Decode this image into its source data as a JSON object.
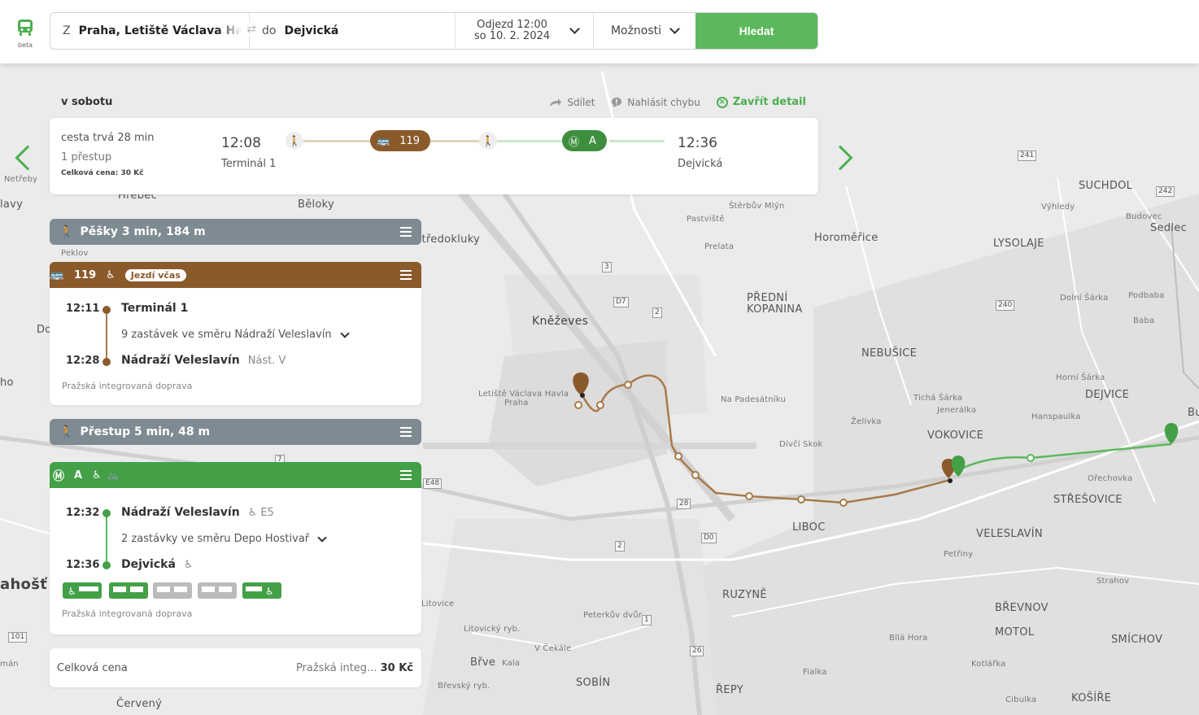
{
  "logo": {
    "beta": "beta",
    "icon": "bus-icon"
  },
  "search": {
    "from_prefix": "Z",
    "from_value": "Praha, Letiště Václava Havla",
    "to_prefix": "do",
    "to_value": "Dejvická",
    "depart_line1": "Odjezd 12:00",
    "depart_line2": "so 10. 2. 2024",
    "options_label": "Možnosti",
    "search_button": "Hledat"
  },
  "detail": {
    "day_label": "v sobotu",
    "share": "Sdílet",
    "report": "Nahlásit chybu",
    "close": "Zavřít detail"
  },
  "summary": {
    "duration": "cesta trvá 28 min",
    "transfers": "1 přestup",
    "price": "Celková cena: 30 Kč",
    "depart_time": "12:08",
    "depart_stop": "Terminál 1",
    "arrive_time": "12:36",
    "arrive_stop": "Dejvická",
    "bus_line": "119",
    "metro_line": "A"
  },
  "colors": {
    "green": "#4caf50",
    "bus_brown": "#8b5a2b",
    "metro_green": "#43a047",
    "walk_gray": "#7e8b93"
  },
  "legs": {
    "walk1": "Pěšky 3 min, 184 m",
    "bus": {
      "line": "119",
      "status": "Jezdí včas",
      "from_time": "12:11",
      "from_stop": "Terminál 1",
      "stops_info": "9 zastávek ve směru Nádraží Veleslavín",
      "to_time": "12:28",
      "to_stop": "Nádraží Veleslavín",
      "to_platform": "Nást. V",
      "operator": "Pražská integrovaná doprava"
    },
    "transfer": "Přestup 5 min, 48 m",
    "metro": {
      "line": "A",
      "from_time": "12:32",
      "from_stop": "Nádraží Veleslavín",
      "from_exit": "E5",
      "stops_info": "2 zastávky ve směru Depo Hostivař",
      "to_time": "12:36",
      "to_stop": "Dejvická",
      "operator": "Pražská integrovaná doprava"
    }
  },
  "price": {
    "label": "Celková cena",
    "provider": "Pražská integ...",
    "amount": "30 Kč"
  },
  "map": {
    "labels": {
      "belok": "Běloky",
      "hrebec": "Hrebec",
      "tredokluky": "Středokluky",
      "peklov": "Peklov",
      "knezeves": "Kněževes",
      "horomerice": "Horoměřice",
      "predni": "PŘEDNÍ",
      "kopanina": "KOPANINA",
      "nebusice": "NEBUŠICE",
      "suchdol": "SUCHDOL",
      "lysolaje": "LYSOLAJE",
      "sedlec": "Sedlec",
      "dejvice": "DEJVICE",
      "vokovice": "VOKOVICE",
      "strešovice": "STŘEŠOVICE",
      "liboc": "LIBOC",
      "veleslavin": "VELESLAVÍN",
      "ruzyne": "RUZYNĚ",
      "brevnov": "BŘEVNOV",
      "motol": "MOTOL",
      "smichov": "SMÍCHOV",
      "sobin": "SOBÍN",
      "repy": "ŘEPY",
      "kosire": "KOŠÍŘE",
      "airport1": "Letiště Václava Havla",
      "airport2": "Praha",
      "netreby": "Netřeby",
      "lavy": "lavy",
      "dot": "Do",
      "ho": "ho",
      "hostedge": "ahošť",
      "cerveny": "Červený",
      "man": "mán",
      "stbmlyn": "Štěrbův Mlýn",
      "pastviste": "Pastviště",
      "prelata": "Prelata",
      "napadesatniku": "Na Padesátníku",
      "zelivka": "Želivka",
      "divcisko": "Dívčí Skok",
      "tichasarka": "Tichá Šárka",
      "jenerálka": "Jenerálka",
      "hornisarka": "Horní Šárka",
      "hanspaulka": "Hanspaulka",
      "orechovka": "Ořechovka",
      "petriny": "Petřiny",
      "strahov": "Strahov",
      "vyhledy": "Výhledy",
      "budovec": "Budovec",
      "dolni": "Dolní Šárka",
      "podbaba": "Podbaba",
      "baba": "Baba",
      "bilahora": "Bílá Hora",
      "kotlarka": "Kotlářka",
      "fialka": "Fialka",
      "petervdvur": "Peterkův dvůr",
      "vcekale": "V Čekále",
      "litovicky": "Litovický ryb.",
      "litovice": "Litovice",
      "kala": "Kala",
      "breve": "Břve",
      "brevsky": "Břevský ryb.",
      "cibulka": "Cibulka",
      "bu": "Bu"
    },
    "roads": {
      "d7": "D7",
      "d0": "D0",
      "e48": "E48",
      "r101": "101",
      "r240": "240",
      "r241": "241",
      "r242": "242",
      "a3": "3",
      "a2": "2",
      "a28": "28",
      "a2b": "2",
      "a1": "1",
      "a26": "26",
      "a7": "7"
    }
  }
}
